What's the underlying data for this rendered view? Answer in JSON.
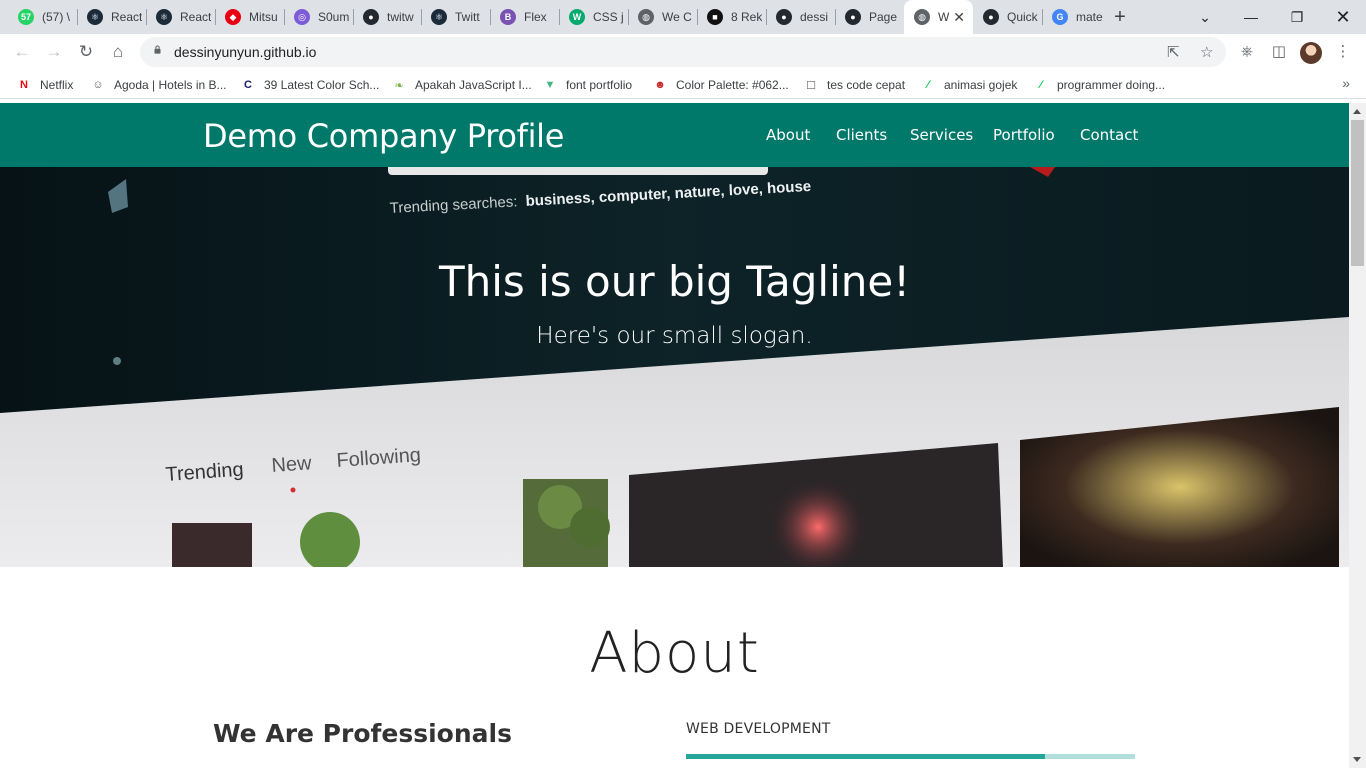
{
  "browser": {
    "tabs": [
      {
        "title": "(57) \\",
        "icon": "whatsapp-icon",
        "color": "#25d366",
        "glyph": "57"
      },
      {
        "title": "React",
        "icon": "react-icon",
        "color": "#1c2b3a",
        "glyph": "⚛"
      },
      {
        "title": "React",
        "icon": "react-icon",
        "color": "#1c2b3a",
        "glyph": "⚛"
      },
      {
        "title": "Mitsu",
        "icon": "mitsubishi-icon",
        "color": "#e60012",
        "glyph": "◆"
      },
      {
        "title": "S0um",
        "icon": "spiral-icon",
        "color": "#7c5cd6",
        "glyph": "◎"
      },
      {
        "title": "twitw",
        "icon": "github-icon",
        "color": "#24292f",
        "glyph": "●"
      },
      {
        "title": "Twitt",
        "icon": "react-icon",
        "color": "#1c2b3a",
        "glyph": "⚛"
      },
      {
        "title": "Flex",
        "icon": "bootstrap-icon",
        "color": "#7952b3",
        "glyph": "B"
      },
      {
        "title": "CSS j",
        "icon": "w3-icon",
        "color": "#04aa6d",
        "glyph": "W"
      },
      {
        "title": "We C",
        "icon": "globe-icon",
        "color": "#5f6368",
        "glyph": "◍"
      },
      {
        "title": "8 Rek",
        "icon": "page-icon",
        "color": "#111111",
        "glyph": "■"
      },
      {
        "title": "dessi",
        "icon": "github-icon",
        "color": "#24292f",
        "glyph": "●"
      },
      {
        "title": "Page",
        "icon": "github-icon",
        "color": "#24292f",
        "glyph": "●"
      },
      {
        "title": "W",
        "icon": "globe-icon",
        "color": "#5f6368",
        "glyph": "◍",
        "active": true
      },
      {
        "title": "Quick",
        "icon": "github-icon",
        "color": "#24292f",
        "glyph": "●"
      },
      {
        "title": "mate",
        "icon": "google-icon",
        "color": "#4285f4",
        "glyph": "G"
      }
    ],
    "url": "dessinyunyun.github.io",
    "bookmarks": [
      {
        "label": "Netflix",
        "icon": "netflix-icon",
        "color": "#e50914",
        "glyph": "N"
      },
      {
        "label": "Agoda | Hotels in B...",
        "icon": "agoda-icon",
        "color": "#555555",
        "glyph": "☺"
      },
      {
        "label": "39 Latest Color Sch...",
        "icon": "colorhunt-icon",
        "color": "#1a1a6e",
        "glyph": "C"
      },
      {
        "label": "Apakah JavaScript I...",
        "icon": "leaf-icon",
        "color": "#7cb342",
        "glyph": "❧"
      },
      {
        "label": "font portfolio",
        "icon": "vue-icon",
        "color": "#41b883",
        "glyph": "▼"
      },
      {
        "label": "Color Palette: #062...",
        "icon": "palette-icon",
        "color": "#c62828",
        "glyph": "☻"
      },
      {
        "label": "tes code cepat",
        "icon": "code-icon",
        "color": "#5f6368",
        "glyph": "☐"
      },
      {
        "label": "animasi gojek",
        "icon": "codepen-icon",
        "color": "#00c853",
        "glyph": "∕"
      },
      {
        "label": "programmer doing...",
        "icon": "codepen-icon",
        "color": "#00c853",
        "glyph": "∕"
      }
    ]
  },
  "site": {
    "brand": "Demo Company Profile",
    "menu": [
      "About",
      "Clients",
      "Services",
      "Portfolio",
      "Contact"
    ],
    "hero": {
      "tagline": "This is our big Tagline!",
      "slogan": "Here's our small slogan.",
      "photo_text": {
        "trending_prefix": "Trending searches:",
        "trending_terms": "business, computer, nature, love, house",
        "tabs": [
          "Trending",
          "New",
          "Following"
        ]
      }
    },
    "about": {
      "title": "About",
      "subtitle": "We Are Professionals",
      "skill": {
        "label": "WEB DEVELOPMENT",
        "value": 0.8
      }
    }
  },
  "colors": {
    "primary": "#00796b",
    "accent": "#26a69a",
    "track": "#b2dfdb"
  }
}
